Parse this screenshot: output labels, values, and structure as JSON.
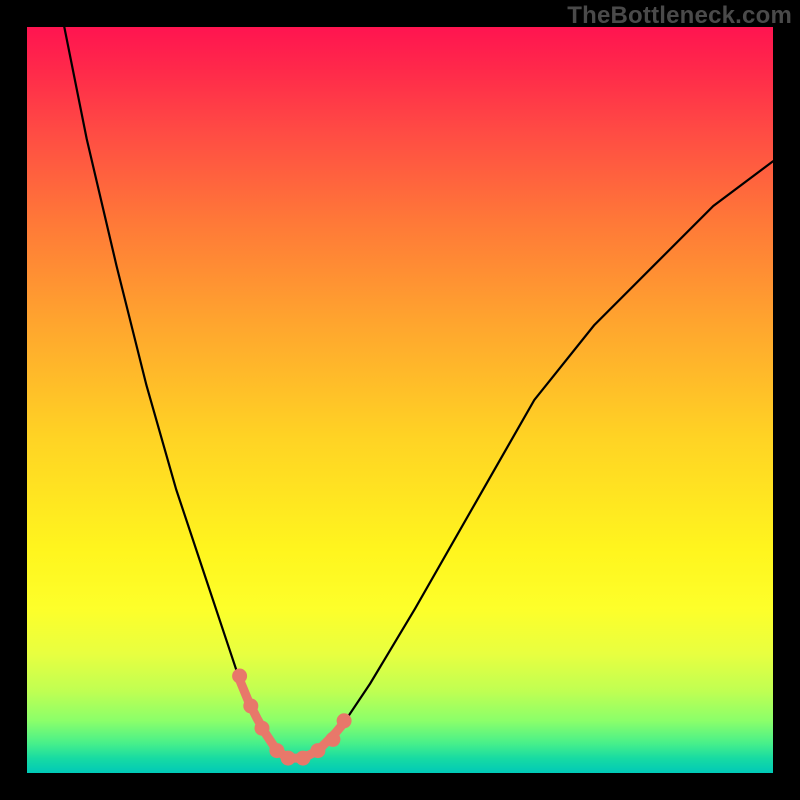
{
  "watermark": "TheBottleneck.com",
  "chart_data": {
    "type": "line",
    "title": "",
    "xlabel": "",
    "ylabel": "",
    "xlim": [
      0,
      100
    ],
    "ylim": [
      0,
      100
    ],
    "grid": false,
    "legend": false,
    "series": [
      {
        "name": "bottleneck-curve",
        "x": [
          5,
          8,
          12,
          16,
          20,
          24,
          27,
          29,
          31.5,
          33.5,
          35,
          37,
          39,
          42,
          46,
          52,
          60,
          68,
          76,
          84,
          92,
          100
        ],
        "values": [
          100,
          85,
          68,
          52,
          38,
          26,
          17,
          11,
          6,
          3,
          2,
          2,
          3,
          6,
          12,
          22,
          36,
          50,
          60,
          68,
          76,
          82
        ]
      }
    ],
    "markers": {
      "name": "highlighted-points",
      "x": [
        28.5,
        30,
        31.5,
        33.5,
        35,
        37,
        39,
        41,
        42.5
      ],
      "values": [
        13,
        9,
        6,
        3,
        2,
        2,
        3,
        4.5,
        7
      ]
    },
    "annotations": []
  },
  "colors": {
    "curve": "#000000",
    "markers": "#e8786a",
    "background_top": "#ff1450",
    "background_bottom": "#00c9b8",
    "frame": "#000000"
  }
}
